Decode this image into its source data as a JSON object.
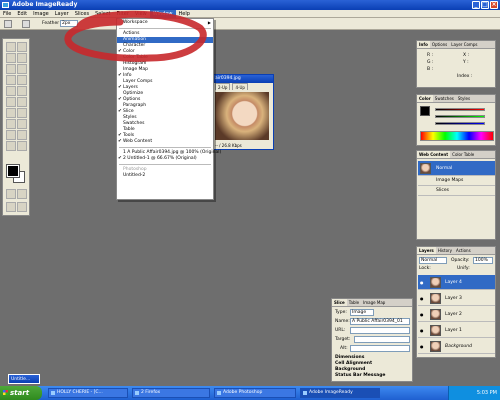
{
  "window": {
    "title": "Adobe ImageReady"
  },
  "menubar": [
    "File",
    "Edit",
    "Image",
    "Layer",
    "Slices",
    "Select",
    "Filter",
    "View",
    "Window",
    "Help"
  ],
  "options_bar": {
    "label": "Feather",
    "value": "2px"
  },
  "window_menu": {
    "items": [
      {
        "label": "Workspace",
        "submenu": true
      },
      {
        "sep": true
      },
      {
        "label": "Actions"
      },
      {
        "label": "Animation",
        "highlight": true
      },
      {
        "label": "Character"
      },
      {
        "label": "Color",
        "checked": true
      },
      {
        "label": "Color Table"
      },
      {
        "label": "Histogram"
      },
      {
        "label": "Image Map"
      },
      {
        "label": "Info",
        "checked": true
      },
      {
        "label": "Layer Comps"
      },
      {
        "label": "Layers",
        "checked": true
      },
      {
        "label": "Optimize"
      },
      {
        "label": "Options",
        "checked": true
      },
      {
        "label": "Paragraph"
      },
      {
        "label": "Slice",
        "checked": true
      },
      {
        "label": "Styles"
      },
      {
        "label": "Swatches"
      },
      {
        "label": "Table"
      },
      {
        "label": "Tools",
        "checked": true
      },
      {
        "label": "Web Content",
        "checked": true
      },
      {
        "sep": true
      },
      {
        "label": "1 A Public Affair0394.jpg @ 100% (Original)"
      },
      {
        "label": "2 Untitled-1 @ 66.67% (Original)",
        "checked": true
      },
      {
        "sep": true
      },
      {
        "label": "Photoshop",
        "disabled": true
      },
      {
        "label": "Untitled-2"
      }
    ]
  },
  "document": {
    "title": "air0394.jpg",
    "tabs": [
      "2-Up",
      "4-Up"
    ],
    "status": "-- / 26.8 Kbps"
  },
  "info_panel": {
    "tabs": [
      "Info",
      "Options",
      "Layer Comps"
    ],
    "fields": [
      "R :",
      "G :",
      "B :",
      "X :",
      "Y :",
      "Index :"
    ]
  },
  "color_panel": {
    "tabs": [
      "Color",
      "Swatches",
      "Styles"
    ]
  },
  "web_content_panel": {
    "tabs": [
      "Web Content",
      "Color Table"
    ],
    "rows": [
      "Normal",
      "Image Maps",
      "Slices"
    ]
  },
  "layers_panel": {
    "tabs": [
      "Layers",
      "History",
      "Actions"
    ],
    "blend_mode": "Normal",
    "opacity_label": "Opacity:",
    "opacity_value": "100%",
    "lock_label": "Lock:",
    "unify_label": "Unify:",
    "layers": [
      {
        "name": "Layer 4",
        "selected": true
      },
      {
        "name": "Layer 3"
      },
      {
        "name": "Layer 2"
      },
      {
        "name": "Layer 1"
      },
      {
        "name": "Background",
        "italic": true
      }
    ]
  },
  "slice_panel": {
    "tabs": [
      "Slice",
      "Table",
      "Image Map"
    ],
    "type_label": "Type:",
    "type_value": "Image",
    "name_label": "Name:",
    "name_value": "A Public Affair0394_01",
    "url_label": "URL:",
    "target_label": "Target:",
    "alt_label": "Alt:",
    "sections": [
      "Dimensions",
      "Cell Alignment",
      "Background",
      "Status Bar Message"
    ]
  },
  "taskbar": {
    "start": "start",
    "tasks": [
      "HOLLY CHERIE - [C...",
      "2 Firefox",
      "Adobe Photoshop",
      "Adobe ImageReady"
    ],
    "active_task": 3,
    "clock": "5:03 PM"
  },
  "minimized_doc": {
    "label": "Untitle..."
  },
  "annotation": {
    "color": "#c8282b",
    "note": ""
  }
}
